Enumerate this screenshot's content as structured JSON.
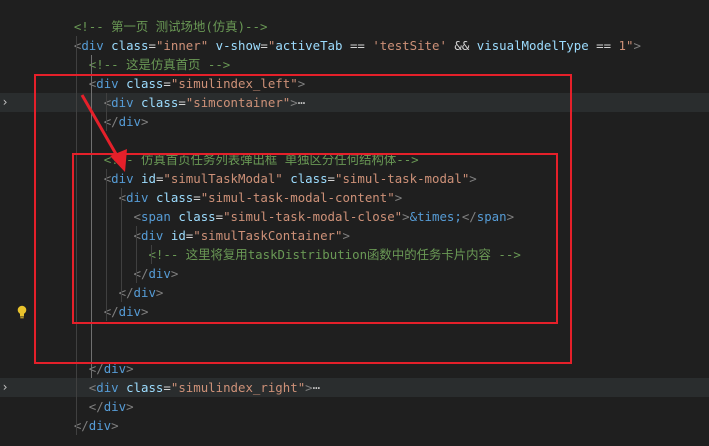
{
  "editor": {
    "lines": [
      {
        "indent": "    ",
        "tokens": [
          {
            "t": "<!-- 第一页 测试场地(仿真)-->",
            "c": "cm"
          }
        ]
      },
      {
        "indent": "    ",
        "tokens": [
          {
            "t": "<",
            "c": "punc"
          },
          {
            "t": "div",
            "c": "tag"
          },
          {
            "t": " ",
            "c": "text"
          },
          {
            "t": "class",
            "c": "attr"
          },
          {
            "t": "=",
            "c": "text"
          },
          {
            "t": "\"inner\"",
            "c": "str"
          },
          {
            "t": " ",
            "c": "text"
          },
          {
            "t": "v-show",
            "c": "attr"
          },
          {
            "t": "=",
            "c": "text"
          },
          {
            "t": "\"",
            "c": "str"
          },
          {
            "t": "activeTab",
            "c": "dir"
          },
          {
            "t": " == ",
            "c": "text"
          },
          {
            "t": "'testSite'",
            "c": "str"
          },
          {
            "t": " && ",
            "c": "text"
          },
          {
            "t": "visualModelType",
            "c": "dir"
          },
          {
            "t": " == ",
            "c": "text"
          },
          {
            "t": "1",
            "c": "str"
          },
          {
            "t": "\"",
            "c": "str"
          },
          {
            "t": ">",
            "c": "punc"
          }
        ]
      },
      {
        "indent": "      ",
        "tokens": [
          {
            "t": "<!-- 这是仿真首页 -->",
            "c": "cm"
          }
        ]
      },
      {
        "indent": "      ",
        "tokens": [
          {
            "t": "<",
            "c": "punc"
          },
          {
            "t": "div",
            "c": "tag"
          },
          {
            "t": " ",
            "c": "text"
          },
          {
            "t": "class",
            "c": "attr"
          },
          {
            "t": "=",
            "c": "text"
          },
          {
            "t": "\"simulindex_left\"",
            "c": "str"
          },
          {
            "t": ">",
            "c": "punc"
          }
        ]
      },
      {
        "indent": "        ",
        "tokens": [
          {
            "t": "<",
            "c": "punc"
          },
          {
            "t": "div",
            "c": "tag"
          },
          {
            "t": " ",
            "c": "text"
          },
          {
            "t": "class",
            "c": "attr"
          },
          {
            "t": "=",
            "c": "text"
          },
          {
            "t": "\"simcontainer\"",
            "c": "str"
          },
          {
            "t": ">",
            "c": "punc"
          },
          {
            "t": "⋯",
            "c": "ell"
          }
        ]
      },
      {
        "indent": "        ",
        "tokens": [
          {
            "t": "</",
            "c": "punc"
          },
          {
            "t": "div",
            "c": "tag"
          },
          {
            "t": ">",
            "c": "punc"
          }
        ]
      },
      {
        "indent": "",
        "tokens": []
      },
      {
        "indent": "        ",
        "tokens": [
          {
            "t": "<!-- 仿真首页任务列表弹出框 单独区分任何结构体-->",
            "c": "cm"
          }
        ]
      },
      {
        "indent": "        ",
        "tokens": [
          {
            "t": "<",
            "c": "punc"
          },
          {
            "t": "div",
            "c": "tag"
          },
          {
            "t": " ",
            "c": "text"
          },
          {
            "t": "id",
            "c": "attr"
          },
          {
            "t": "=",
            "c": "text"
          },
          {
            "t": "\"simulTaskModal\"",
            "c": "str"
          },
          {
            "t": " ",
            "c": "text"
          },
          {
            "t": "class",
            "c": "attr"
          },
          {
            "t": "=",
            "c": "text"
          },
          {
            "t": "\"simul-task-modal\"",
            "c": "str"
          },
          {
            "t": ">",
            "c": "punc"
          }
        ]
      },
      {
        "indent": "          ",
        "tokens": [
          {
            "t": "<",
            "c": "punc"
          },
          {
            "t": "div",
            "c": "tag"
          },
          {
            "t": " ",
            "c": "text"
          },
          {
            "t": "class",
            "c": "attr"
          },
          {
            "t": "=",
            "c": "text"
          },
          {
            "t": "\"simul-task-modal-content\"",
            "c": "str"
          },
          {
            "t": ">",
            "c": "punc"
          }
        ]
      },
      {
        "indent": "            ",
        "tokens": [
          {
            "t": "<",
            "c": "punc"
          },
          {
            "t": "span",
            "c": "tag"
          },
          {
            "t": " ",
            "c": "text"
          },
          {
            "t": "class",
            "c": "attr"
          },
          {
            "t": "=",
            "c": "text"
          },
          {
            "t": "\"simul-task-modal-close\"",
            "c": "str"
          },
          {
            "t": ">",
            "c": "punc"
          },
          {
            "t": "&times;",
            "c": "ent"
          },
          {
            "t": "</",
            "c": "punc"
          },
          {
            "t": "span",
            "c": "tag"
          },
          {
            "t": ">",
            "c": "punc"
          }
        ]
      },
      {
        "indent": "            ",
        "tokens": [
          {
            "t": "<",
            "c": "punc"
          },
          {
            "t": "div",
            "c": "tag"
          },
          {
            "t": " ",
            "c": "text"
          },
          {
            "t": "id",
            "c": "attr"
          },
          {
            "t": "=",
            "c": "text"
          },
          {
            "t": "\"simulTaskContainer\"",
            "c": "str"
          },
          {
            "t": ">",
            "c": "punc"
          }
        ]
      },
      {
        "indent": "              ",
        "tokens": [
          {
            "t": "<!-- 这里将复用taskDistribution函数中的任务卡片内容 -->",
            "c": "cm"
          }
        ]
      },
      {
        "indent": "            ",
        "tokens": [
          {
            "t": "</",
            "c": "punc"
          },
          {
            "t": "div",
            "c": "tag"
          },
          {
            "t": ">",
            "c": "punc"
          }
        ]
      },
      {
        "indent": "          ",
        "tokens": [
          {
            "t": "</",
            "c": "punc"
          },
          {
            "t": "div",
            "c": "tag"
          },
          {
            "t": ">",
            "c": "punc"
          }
        ]
      },
      {
        "indent": "        ",
        "tokens": [
          {
            "t": "</",
            "c": "punc"
          },
          {
            "t": "div",
            "c": "tag"
          },
          {
            "t": ">",
            "c": "punc"
          }
        ]
      },
      {
        "indent": "",
        "tokens": []
      },
      {
        "indent": "",
        "tokens": []
      },
      {
        "indent": "      ",
        "tokens": [
          {
            "t": "</",
            "c": "punc"
          },
          {
            "t": "div",
            "c": "tag"
          },
          {
            "t": ">",
            "c": "punc"
          }
        ]
      },
      {
        "indent": "      ",
        "tokens": [
          {
            "t": "<",
            "c": "punc"
          },
          {
            "t": "div",
            "c": "tag"
          },
          {
            "t": " ",
            "c": "text"
          },
          {
            "t": "class",
            "c": "attr"
          },
          {
            "t": "=",
            "c": "text"
          },
          {
            "t": "\"simulindex_right\"",
            "c": "str"
          },
          {
            "t": ">",
            "c": "punc"
          },
          {
            "t": "⋯",
            "c": "ell"
          }
        ]
      },
      {
        "indent": "      ",
        "tokens": [
          {
            "t": "</",
            "c": "punc"
          },
          {
            "t": "div",
            "c": "tag"
          },
          {
            "t": ">",
            "c": "punc"
          }
        ]
      },
      {
        "indent": "    ",
        "tokens": [
          {
            "t": "</",
            "c": "punc"
          },
          {
            "t": "div",
            "c": "tag"
          },
          {
            "t": ">",
            "c": "punc"
          }
        ]
      }
    ],
    "fold_markers": [
      {
        "line": 4,
        "icon": "chevron-right-icon"
      },
      {
        "line": 19,
        "icon": "chevron-right-icon"
      }
    ],
    "lightbulb": {
      "line": 15,
      "icon": "lightbulb-icon"
    },
    "highlighted_lines": [
      4,
      19
    ],
    "colors": {
      "comment": "#6a9955",
      "tag": "#569cd6",
      "attribute": "#9cdcfe",
      "string": "#ce9178",
      "annotation": "#e5202a",
      "background": "#1f1f1f"
    }
  }
}
